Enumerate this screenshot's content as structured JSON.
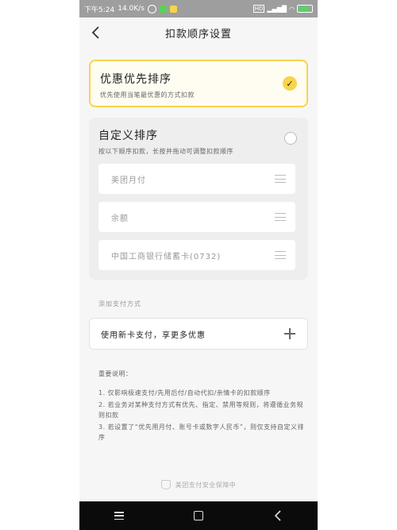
{
  "statusbar": {
    "time": "下午5:24",
    "speed": "14.0K/s",
    "network": "HD"
  },
  "header": {
    "title": "扣款顺序设置"
  },
  "preferred_option": {
    "title": "优惠优先排序",
    "subtitle": "优先使用当笔最优惠的方式扣款",
    "selected": true
  },
  "custom_option": {
    "title": "自定义排序",
    "subtitle": "按以下顺序扣款，长按并拖动可调整扣款顺序",
    "selected": false,
    "payment_methods": [
      {
        "label": "美团月付"
      },
      {
        "label": "余额"
      },
      {
        "label": "中国工商银行储蓄卡(0732)"
      }
    ]
  },
  "add_payment": {
    "section_label": "添加支付方式",
    "card_label": "使用新卡支付，享更多优惠"
  },
  "notes": {
    "title": "重要说明：",
    "items": [
      "1. 仅影响极速支付/先用后付/自动代扣/亲情卡的扣款顺序",
      "2. 若业务对某种支付方式有优先、指定、禁用等规则，将遵循业务规则扣款",
      "3. 若设置了“优先用月付、账号卡或数字人民币”，则仅支持自定义排序"
    ]
  },
  "footer": {
    "text": "美团支付安全保障中"
  },
  "colors": {
    "accent": "#f8d44b",
    "background": "#f6f6f6"
  }
}
